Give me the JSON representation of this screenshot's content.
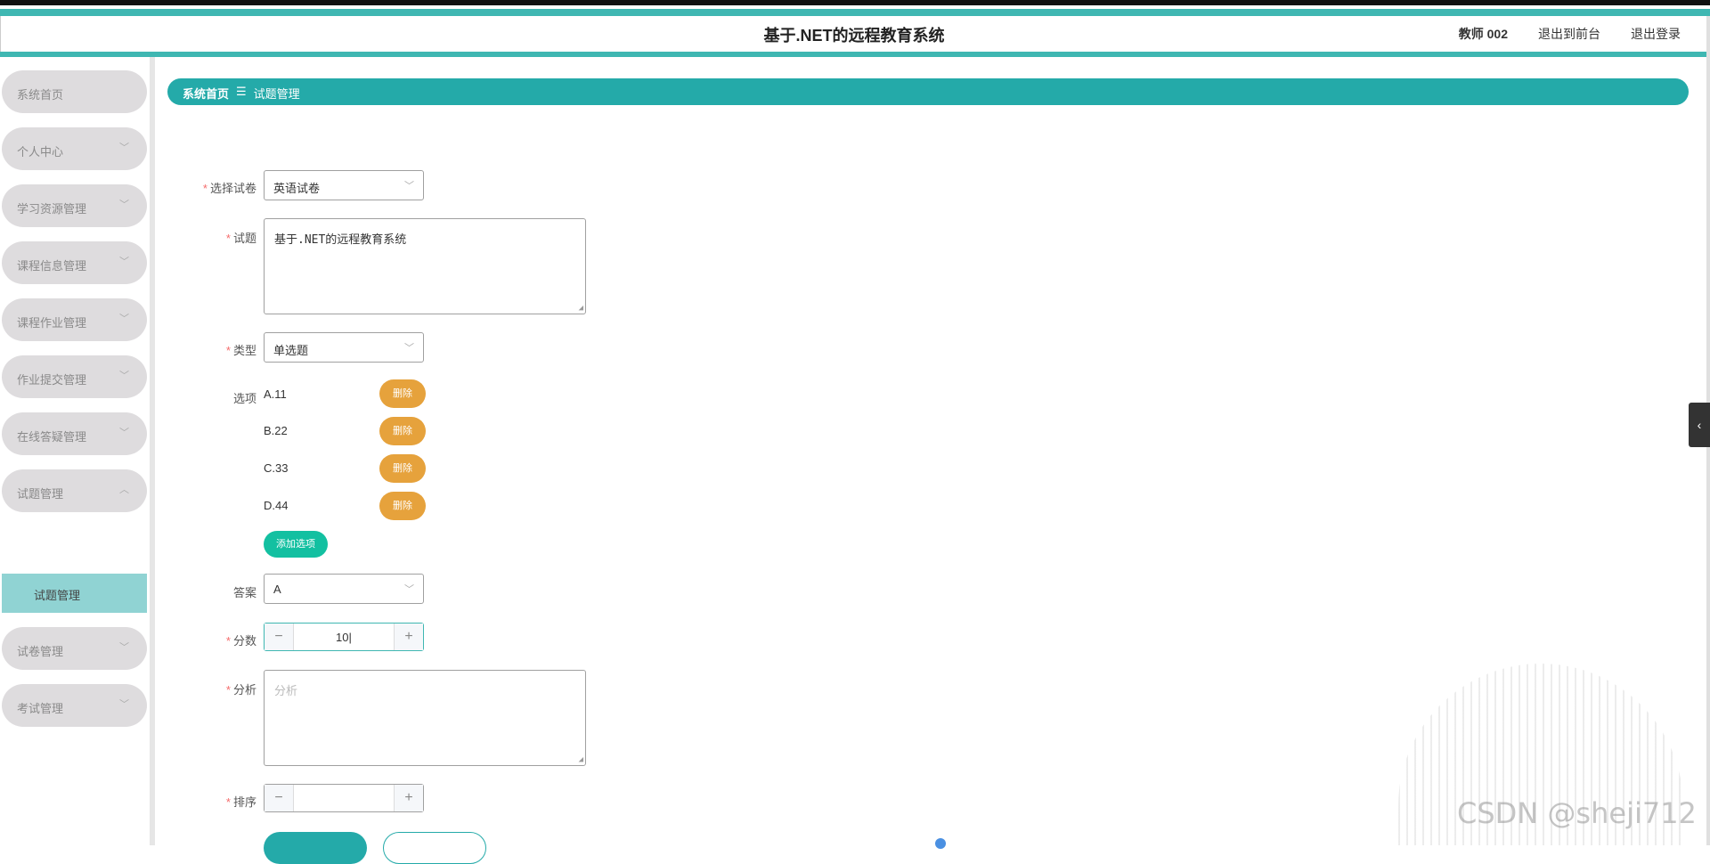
{
  "header": {
    "title": "基于.NET的远程教育系统",
    "user": "教师 002",
    "front_link": "退出到前台",
    "logout_link": "退出登录"
  },
  "sidebar": {
    "items": [
      {
        "label": "系统首页",
        "has_chevron": false
      },
      {
        "label": "个人中心",
        "has_chevron": true
      },
      {
        "label": "学习资源管理",
        "has_chevron": true
      },
      {
        "label": "课程信息管理",
        "has_chevron": true
      },
      {
        "label": "课程作业管理",
        "has_chevron": true
      },
      {
        "label": "作业提交管理",
        "has_chevron": true
      },
      {
        "label": "在线答疑管理",
        "has_chevron": true
      },
      {
        "label": "试题管理",
        "has_chevron": true,
        "expanded": true
      },
      {
        "label": "试卷管理",
        "has_chevron": true
      },
      {
        "label": "考试管理",
        "has_chevron": true
      }
    ],
    "submenu_label": "试题管理"
  },
  "breadcrumb": {
    "home": "系统首页",
    "separator": "☰",
    "current": "试题管理"
  },
  "form": {
    "paper": {
      "label": "选择试卷",
      "value": "英语试卷"
    },
    "question": {
      "label": "试题",
      "value": "基于.NET的远程教育系统"
    },
    "type": {
      "label": "类型",
      "value": "单选题"
    },
    "options": {
      "label": "选项",
      "items": [
        "A.11",
        "B.22",
        "C.33",
        "D.44"
      ],
      "delete_label": "删除",
      "add_label": "添加选项"
    },
    "answer": {
      "label": "答案",
      "value": "A"
    },
    "score": {
      "label": "分数",
      "value": "10|"
    },
    "analysis": {
      "label": "分析",
      "placeholder": "分析"
    },
    "sort": {
      "label": "排序",
      "value": ""
    }
  },
  "watermark": "CSDN @sheji712",
  "colors": {
    "accent": "#24aaa9",
    "header_stripe": "#3fb7b2",
    "delete_button": "#e6a23c",
    "add_button": "#13c0a1",
    "sidebar_item": "#dedcde",
    "submenu_active": "#90d3d3"
  }
}
